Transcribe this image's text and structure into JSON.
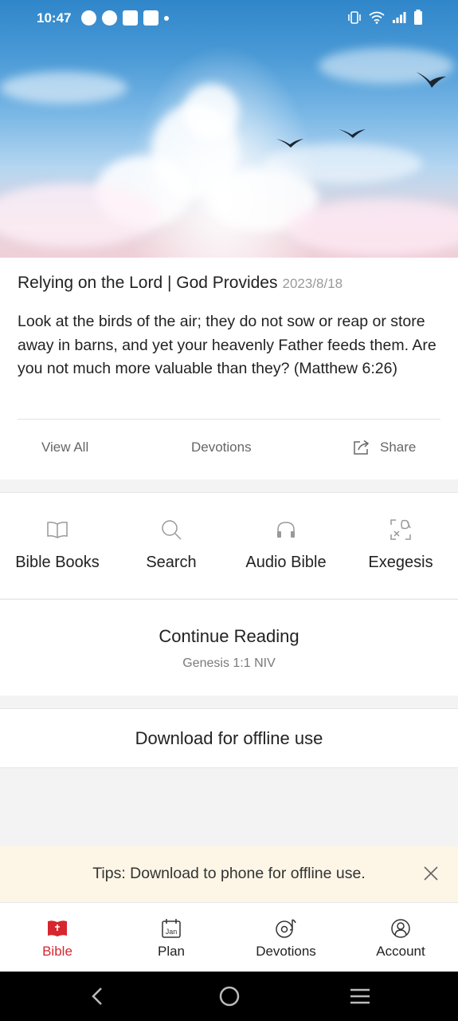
{
  "status_bar": {
    "time": "10:47",
    "notification_icons": [
      "message-icon",
      "check-circle-icon",
      "mail-icon",
      "mail-icon",
      "dot-icon"
    ],
    "system_icons": [
      "vibrate-icon",
      "wifi-icon",
      "signal-icon",
      "battery-icon"
    ]
  },
  "devotion": {
    "title": "Relying on the Lord | God Provides",
    "date": "2023/8/18",
    "verse": "Look at the birds of the air; they do not sow or reap or store away in barns, and yet your heavenly Father feeds them. Are you not much more valuable than they? (Matthew 6:26)",
    "actions": {
      "view_all": "View All",
      "devotions": "Devotions",
      "share": "Share"
    }
  },
  "quick_links": [
    {
      "label": "Bible Books",
      "icon": "book-icon"
    },
    {
      "label": "Search",
      "icon": "search-icon"
    },
    {
      "label": "Audio Bible",
      "icon": "headphones-icon"
    },
    {
      "label": "Exegesis",
      "icon": "exegesis-icon"
    }
  ],
  "continue_reading": {
    "title": "Continue Reading",
    "reference": "Genesis 1:1 NIV"
  },
  "download": {
    "label": "Download for offline use"
  },
  "tips": {
    "text": "Tips: Download to phone for offline use."
  },
  "tabs": [
    {
      "label": "Bible",
      "icon": "bible-icon",
      "active": true
    },
    {
      "label": "Plan",
      "icon": "calendar-icon",
      "icon_text": "Jan",
      "active": false
    },
    {
      "label": "Devotions",
      "icon": "music-disc-icon",
      "active": false
    },
    {
      "label": "Account",
      "icon": "account-icon",
      "active": false
    }
  ],
  "colors": {
    "accent": "#d6262f",
    "tips_bg": "#fdf6e7",
    "muted": "#9a9a9a"
  }
}
